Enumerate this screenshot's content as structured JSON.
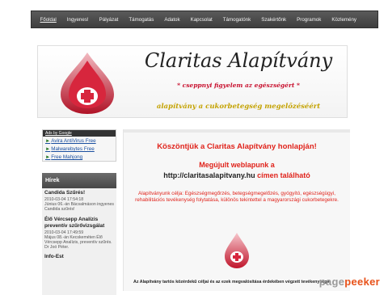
{
  "nav": {
    "items": [
      {
        "label": "Főoldal",
        "active": true
      },
      {
        "label": "Ingyenes!",
        "active": false
      },
      {
        "label": "Pályázat",
        "active": false
      },
      {
        "label": "Támogatás",
        "active": false
      },
      {
        "label": "Adatok",
        "active": false
      },
      {
        "label": "Kapcsolat",
        "active": false
      },
      {
        "label": "Támogatónk",
        "active": false
      },
      {
        "label": "Szakértőnk",
        "active": false
      },
      {
        "label": "Programok",
        "active": false
      },
      {
        "label": "Közlemény",
        "active": false
      }
    ]
  },
  "header": {
    "title": "Claritas Alapítvány",
    "motto": "* cseppnyi figyelem az egészségért *",
    "subtitle": "alapítvány a cukorbetegség megelőzéséért"
  },
  "ads": {
    "title": "Ads by Google",
    "links": [
      "Avira AntiVirus Free",
      "Malwarebytes Free",
      "Free Mahjong"
    ]
  },
  "news": {
    "heading": "Hírek",
    "items": [
      {
        "title": "Candida Szűrés!",
        "date": "2010-03-04 17:54:18",
        "desc": "Június 06.-án Bácsalmáson ingyenes Candida szűrés!"
      },
      {
        "title": "Élő Vércsepp Analízis preventív szűrővizsgálat",
        "date": "2010-03-04 17:49:59",
        "desc": "Május 08.-án Kecskeméten Élő Vércsepp Analízis, preventív szűrés. Dr Joó Péter."
      },
      {
        "title": "Info-Est",
        "date": "",
        "desc": ""
      }
    ]
  },
  "main": {
    "welcome": "Köszöntjük a Claritas Alapítvány honlapján!",
    "update_line1": "Megújult weblapunk a",
    "update_url": "http://claritasalapitvany.hu",
    "update_suffix": "címen található",
    "purpose": "Alapítványunk célja: Egészségmegőrzés, betegségmegelőzés, gyógyító, egészségügyi, rehabilitációs tevékenység folytatása, különös tekintettel a magyarországi cukorbetegekre.",
    "bottom": "Az Alapítvány tartós közérdekű céljai és az ezek megvalósítása érdekében végzett tevékenysége:"
  },
  "watermark": {
    "part1": "page",
    "part2": "peeker"
  },
  "colors": {
    "accent_red": "#e0231b",
    "nav_bg": "#4a4a4a",
    "gold": "#c4a200"
  }
}
